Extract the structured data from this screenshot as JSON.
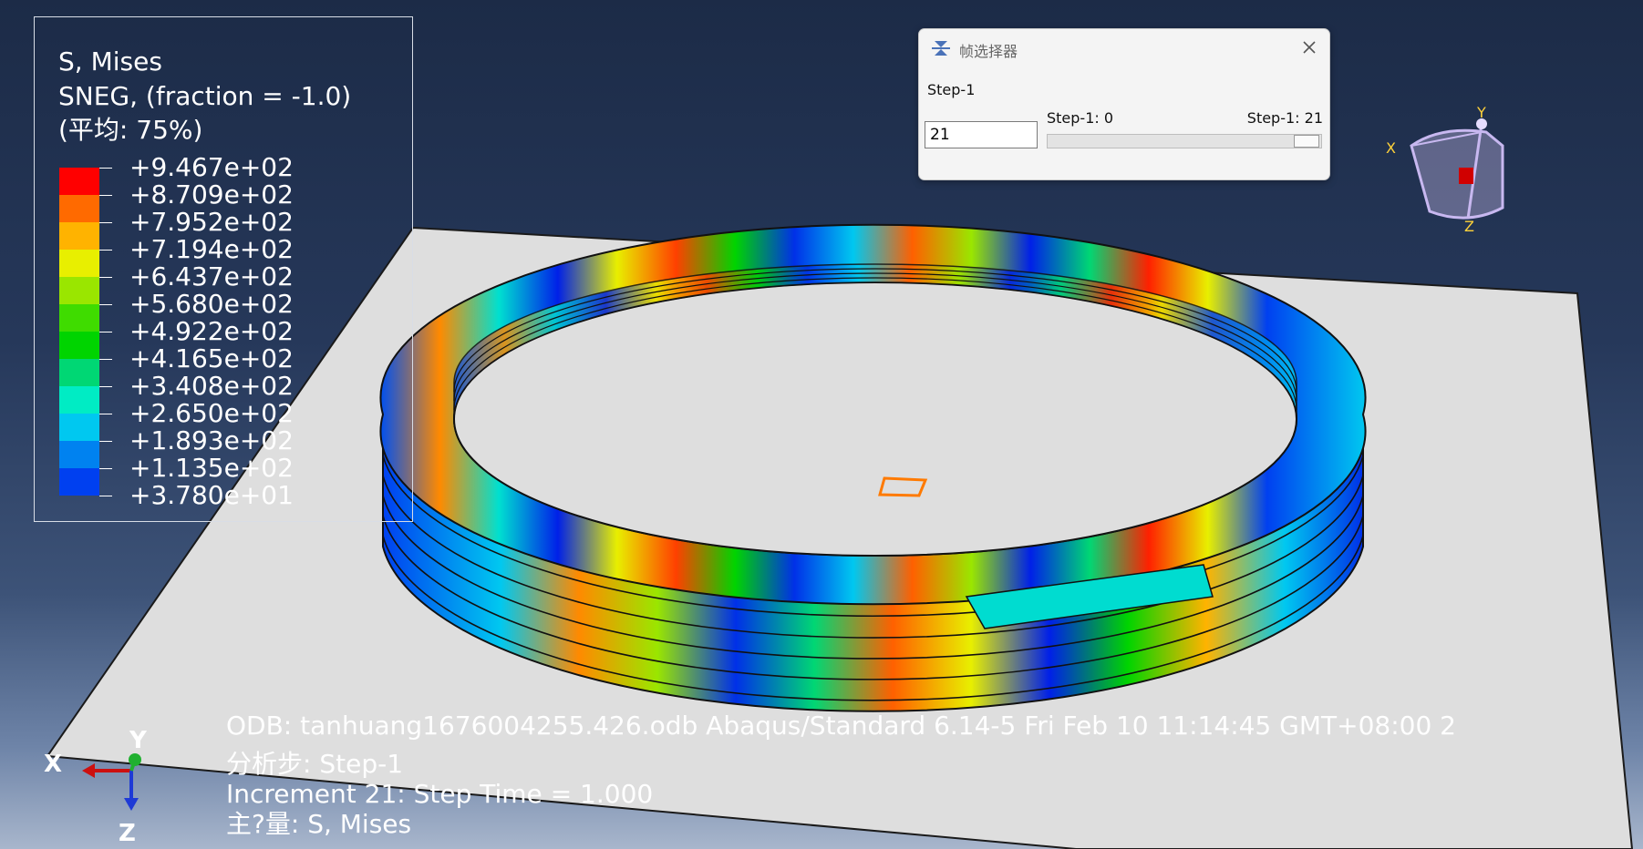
{
  "legend": {
    "title_line1": "S, Mises",
    "title_line2": "SNEG, (fraction = -1.0)",
    "title_line3": "(平均: 75%)",
    "values": [
      "+9.467e+02",
      "+8.709e+02",
      "+7.952e+02",
      "+7.194e+02",
      "+6.437e+02",
      "+5.680e+02",
      "+4.922e+02",
      "+4.165e+02",
      "+3.408e+02",
      "+2.650e+02",
      "+1.893e+02",
      "+1.135e+02",
      "+3.780e+01"
    ],
    "colors": [
      "#ff0000",
      "#ff6a00",
      "#ffb300",
      "#e8ef00",
      "#9ae600",
      "#3fdc00",
      "#00d400",
      "#00d774",
      "#00ecc4",
      "#00c8f0",
      "#0082f0",
      "#0040f0",
      "#0000e8"
    ]
  },
  "frame_selector": {
    "title": "帧选择器",
    "step_label": "Step-1",
    "min_label": "Step-1: 0",
    "max_label": "Step-1: 21",
    "frame_value": "21",
    "slider_fraction": 1.0
  },
  "info": {
    "line1": "ODB: tanhuang1676004255.426.odb    Abaqus/Standard 6.14-5    Fri Feb 10 11:14:45 GMT+08:00 2",
    "line2": "分析步: Step-1",
    "line3": "Increment     21: Step Time =    1.000",
    "line4": "主?量: S, Mises"
  },
  "triad": {
    "x": "X",
    "y": "Y",
    "z": "Z"
  },
  "view_cube": {
    "x": "X",
    "y": "Y",
    "z": "Z"
  },
  "colors": {
    "background_top": "#1c2b47",
    "background_bottom": "#a8b6cc",
    "plate": "#dedede",
    "edge": "#1a1a1a"
  }
}
